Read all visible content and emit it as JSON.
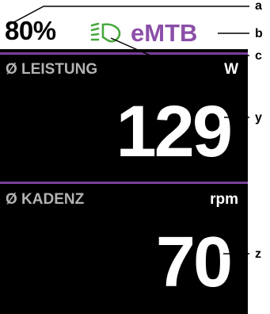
{
  "status": {
    "battery": "80%",
    "light_icon": "headlight-icon",
    "mode": "eMTB"
  },
  "fields": [
    {
      "label": "Ø LEISTUNG",
      "unit": "W",
      "value": "129"
    },
    {
      "label": "Ø KADENZ",
      "unit": "rpm",
      "value": "70"
    }
  ],
  "callouts": [
    "a",
    "b",
    "c",
    "y",
    "z"
  ],
  "colors": {
    "screen_bg": "#000000",
    "topbar_bg": "#ffffff",
    "mode_color": "#8b4fa8",
    "divider_color": "#7a3f9a",
    "light_icon_color": "#46a83c",
    "label_color": "#b3b3b3"
  }
}
